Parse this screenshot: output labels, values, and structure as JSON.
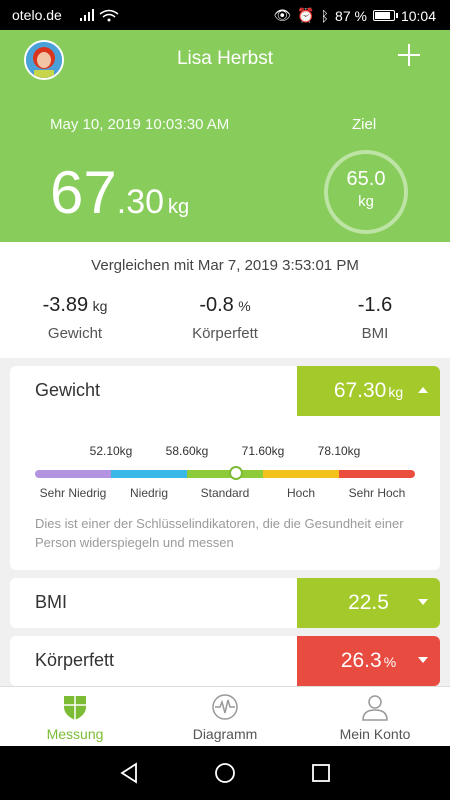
{
  "status": {
    "carrier": "otelo.de",
    "battery": "87 %",
    "time": "10:04"
  },
  "header": {
    "user_name": "Lisa Herbst",
    "timestamp": "May 10, 2019 10:03:30 AM",
    "goal_label": "Ziel",
    "weight_int": "67",
    "weight_dec": ".30",
    "weight_unit": "kg",
    "goal_value": "65.0",
    "goal_unit": "kg"
  },
  "compare": {
    "title": "Vergleichen mit Mar 7, 2019 3:53:01 PM",
    "items": [
      {
        "value": "-3.89",
        "unit": "kg",
        "label": "Gewicht"
      },
      {
        "value": "-0.8",
        "unit": "%",
        "label": "Körperfett"
      },
      {
        "value": "-1.6",
        "unit": "",
        "label": "BMI"
      }
    ]
  },
  "cards": {
    "weight": {
      "title": "Gewicht",
      "value": "67.30",
      "unit": "kg",
      "color": "#a4c92a",
      "thresholds": [
        "52.10kg",
        "58.60kg",
        "71.60kg",
        "78.10kg"
      ],
      "segments": [
        "Sehr Niedrig",
        "Niedrig",
        "Standard",
        "Hoch",
        "Sehr Hoch"
      ],
      "segment_colors": [
        "#b294e0",
        "#39b8e8",
        "#8ecb3a",
        "#f2c21a",
        "#ec4e3d"
      ],
      "indicator_fraction": 0.53,
      "description": "Dies ist einer der Schlüsselindikatoren, die die Gesundheit einer Person widerspiegeln und messen"
    },
    "bmi": {
      "title": "BMI",
      "value": "22.5",
      "unit": "",
      "color": "#a4c92a"
    },
    "fat": {
      "title": "Körperfett",
      "value": "26.3",
      "unit": "%",
      "color": "#e84b3f"
    }
  },
  "tabs": [
    {
      "label": "Messung",
      "icon": "shield-grid-icon",
      "active": true
    },
    {
      "label": "Diagramm",
      "icon": "heartbeat-icon",
      "active": false
    },
    {
      "label": "Mein Konto",
      "icon": "person-icon",
      "active": false
    }
  ],
  "accent_color": "#88cd5c"
}
